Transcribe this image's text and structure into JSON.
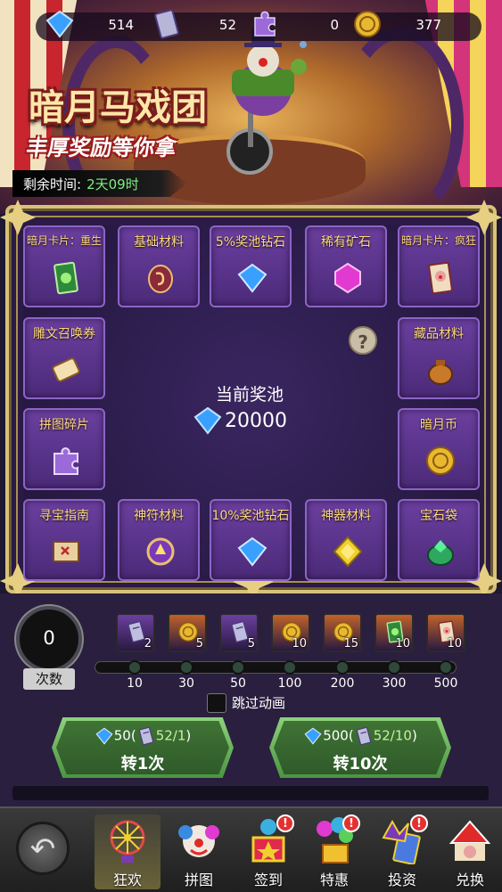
{
  "resources": [
    {
      "icon": "diamond-icon",
      "value": "514"
    },
    {
      "icon": "card-ticket-icon",
      "value": "52"
    },
    {
      "icon": "puzzle-piece-icon",
      "value": "0"
    },
    {
      "icon": "gold-coin-icon",
      "value": "377"
    }
  ],
  "event": {
    "title": "暗月马戏团",
    "subtitle": "丰厚奖励等你拿",
    "timer_label": "剩余时间:",
    "timer_value": "2天09时"
  },
  "board": {
    "slots": [
      {
        "label": "暗月卡片：重生",
        "icon": "green-card-icon",
        "small": true
      },
      {
        "label": "基础材料",
        "icon": "rune-stone-icon"
      },
      {
        "label": "5%奖池钻石",
        "icon": "diamond-icon"
      },
      {
        "label": "稀有矿石",
        "icon": "pink-gem-icon"
      },
      {
        "label": "暗月卡片：疯狂",
        "icon": "clown-card-icon",
        "small": true
      },
      {
        "label": "雕文召唤券",
        "icon": "scroll-icon"
      },
      {
        "label": "藏品材料",
        "icon": "sack-icon"
      },
      {
        "label": "拼图碎片",
        "icon": "puzzle-piece-icon"
      },
      {
        "label": "暗月币",
        "icon": "gold-coin-icon"
      },
      {
        "label": "寻宝指南",
        "icon": "treasure-map-icon"
      },
      {
        "label": "神符材料",
        "icon": "rune-orb-icon"
      },
      {
        "label": "10%奖池钻石",
        "icon": "diamond-icon"
      },
      {
        "label": "神器材料",
        "icon": "yellow-gem-icon"
      },
      {
        "label": "宝石袋",
        "icon": "gem-bag-icon"
      }
    ],
    "pool_title": "当前奖池",
    "pool_value": "20000",
    "help": "?"
  },
  "progress": {
    "count": "0",
    "count_label": "次数",
    "rewards": [
      {
        "icon": "card-ticket-icon",
        "count": "2",
        "color": "#6b3fa0"
      },
      {
        "icon": "gold-coin-icon",
        "count": "5",
        "color": "#c0622a"
      },
      {
        "icon": "card-ticket-icon",
        "count": "5",
        "color": "#6b3fa0"
      },
      {
        "icon": "gold-coin-icon",
        "count": "10",
        "color": "#c0622a"
      },
      {
        "icon": "gold-coin-icon",
        "count": "15",
        "color": "#c0622a"
      },
      {
        "icon": "green-card-icon",
        "count": "10",
        "color": "#c0622a"
      },
      {
        "icon": "clown-card-icon",
        "count": "10",
        "color": "#c0622a"
      }
    ],
    "milestones": [
      "10",
      "30",
      "50",
      "100",
      "200",
      "300",
      "500"
    ],
    "skip_label": "跳过动画"
  },
  "spin": [
    {
      "cost": "50",
      "tickets": "52/1",
      "action": "转1次"
    },
    {
      "cost": "500",
      "tickets": "52/10",
      "action": "转10次"
    }
  ],
  "nav": {
    "tabs": [
      {
        "label": "狂欢",
        "icon": "ferris-wheel-icon",
        "selected": true,
        "badge": ""
      },
      {
        "label": "拼图",
        "icon": "clown-face-icon",
        "selected": false,
        "badge": ""
      },
      {
        "label": "签到",
        "icon": "jester-box-icon",
        "selected": false,
        "badge": "!"
      },
      {
        "label": "特惠",
        "icon": "balloons-gift-icon",
        "selected": false,
        "badge": "!"
      },
      {
        "label": "投资",
        "icon": "jester-hat-cards-icon",
        "selected": false,
        "badge": "!"
      },
      {
        "label": "兑换",
        "icon": "circus-tent-icon",
        "selected": false,
        "badge": ""
      }
    ]
  },
  "colors": {
    "gold": "#d8c27a",
    "panel": "#2a1a45",
    "slot": "#6b3fa0",
    "label": "#ffd97a",
    "button": "#4b9440"
  }
}
